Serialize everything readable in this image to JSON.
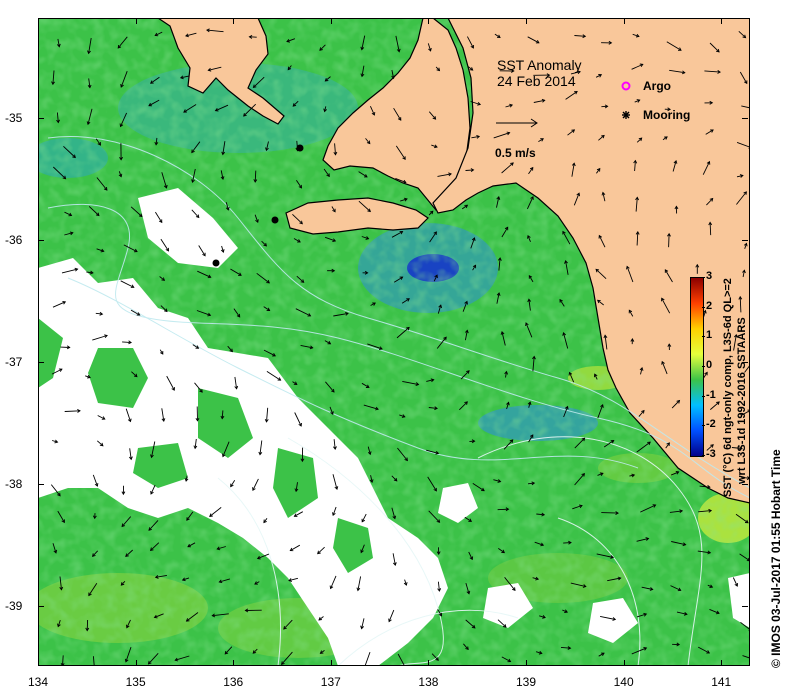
{
  "map": {
    "title_line1": "SST Anomaly",
    "title_line2": "24 Feb 2014",
    "vector_scale_label": "0.5 m/s",
    "legend": [
      {
        "label": "Argo",
        "symbol": "ring",
        "color": "#ff00ff"
      },
      {
        "label": "Mooring",
        "symbol": "star",
        "color": "#000000"
      }
    ],
    "x_ticks": [
      "134",
      "135",
      "136",
      "137",
      "138",
      "139",
      "140",
      "141"
    ],
    "y_ticks": [
      "-35",
      "-36",
      "-37",
      "-38",
      "-39"
    ],
    "colors": {
      "land": "#f9c79a",
      "ocean_main": "#3cc248",
      "missing": "#ffffff"
    }
  },
  "colorbar": {
    "ticks": [
      "3",
      "2",
      "1",
      "0",
      "-1",
      "-2",
      "-3"
    ],
    "label_line1": "SST (°C) 6d ngt-only comp, L3S-6d QL>=2",
    "label_line2": "wrt L3S-1d 1992-2016 SSTAARS",
    "stops": [
      "#8b0000",
      "#ff4000",
      "#ffd000",
      "#e6ff3c",
      "#3cc248",
      "#00c0ff",
      "#0050ff",
      "#00008b"
    ]
  },
  "credit": "© IMOS 03-Jul-2017 01:55 Hobart Time"
}
